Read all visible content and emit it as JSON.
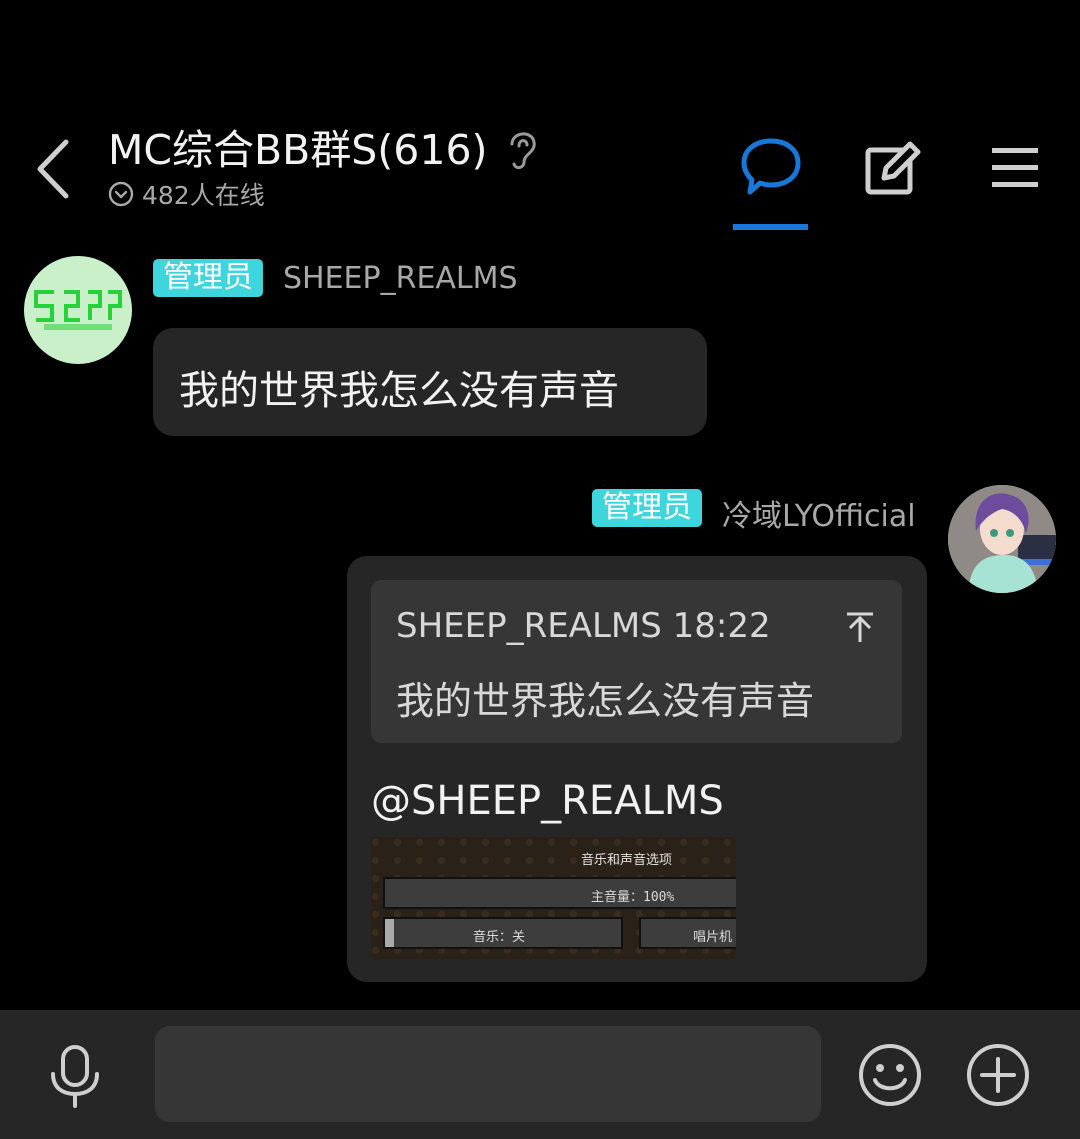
{
  "header": {
    "title": "MC综合BB群S(616)",
    "online": "482人在线"
  },
  "messages": [
    {
      "badge": "管理员",
      "sender": "SHEEP_REALMS",
      "avatar_text": "SHEEP REALMS",
      "text": "我的世界我怎么没有声音"
    },
    {
      "badge": "管理员",
      "sender": "冷域LYOfficial",
      "quote": {
        "author_time": "SHEEP_REALMS 18:22",
        "text": "我的世界我怎么没有声音"
      },
      "mention": "@SHEEP_REALMS",
      "image": {
        "title": "音乐和声音选项",
        "master_volume": "主音量：100%",
        "music": "音乐：关",
        "jukebox": "唱片机"
      }
    }
  ],
  "colors": {
    "accent": "#1678d8",
    "badge": "#3ed6dc",
    "bubble": "#262626",
    "avatar_green": "#c9f0c9"
  }
}
